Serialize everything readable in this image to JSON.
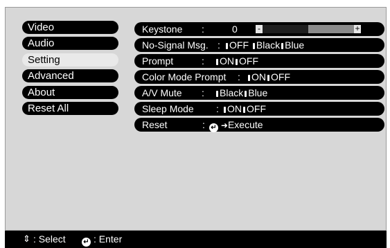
{
  "menu": {
    "items": [
      {
        "label": "Video",
        "selected": false
      },
      {
        "label": "Audio",
        "selected": false
      },
      {
        "label": "Setting",
        "selected": true
      },
      {
        "label": "Advanced",
        "selected": false
      },
      {
        "label": "About",
        "selected": false
      },
      {
        "label": "Reset All",
        "selected": false
      }
    ]
  },
  "settings": {
    "keystone": {
      "label": "Keystone",
      "colon": ":",
      "value": "0",
      "minus": "-",
      "plus": "+",
      "level": 0.5
    },
    "no_signal": {
      "label": "No-Signal Msg.",
      "colon": ":",
      "opt1": "OFF",
      "opt2": "Black",
      "opt3": "Blue"
    },
    "prompt": {
      "label": "Prompt",
      "colon": ":",
      "opt1": "ON",
      "opt2": "OFF"
    },
    "color_mode_prompt": {
      "label": "Color Mode Prompt",
      "colon": ":",
      "opt1": "ON",
      "opt2": "OFF"
    },
    "av_mute": {
      "label": "A/V Mute",
      "colon": ":",
      "opt1": "Black",
      "opt2": "Blue"
    },
    "sleep_mode": {
      "label": "Sleep Mode",
      "colon": ":",
      "opt1": "ON",
      "opt2": "OFF"
    },
    "reset": {
      "label": "Reset",
      "colon": ":",
      "action": "Execute"
    }
  },
  "footer": {
    "select_label": ": Select",
    "enter_label": ": Enter"
  },
  "colors": {
    "panel": "#d7d7d7",
    "item_bg": "#000000",
    "selected_bg": "#e9e9e9"
  },
  "icons": {
    "select": "up-down-arrow-icon",
    "enter": "enter-icon",
    "execute": "right-arrow-icon"
  }
}
